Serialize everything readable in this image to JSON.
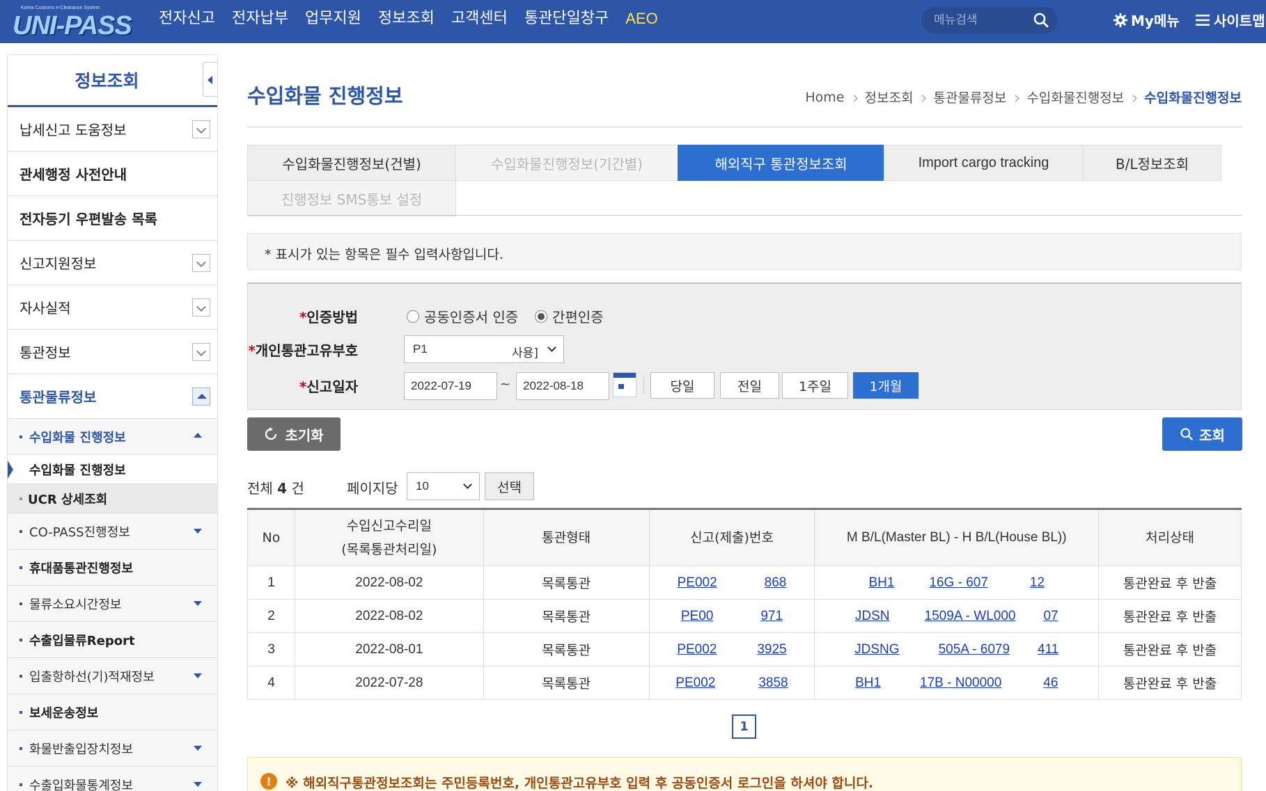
{
  "header": {
    "logo_small": "Korea Customs e-Clearance System",
    "logo_text": "UNI-PASS",
    "nav": [
      "전자신고",
      "전자납부",
      "업무지원",
      "정보조회",
      "고객센터",
      "통관단일창구",
      "AEO"
    ],
    "menu_search_placeholder": "메뉴검색",
    "mymenu_label": "My메뉴",
    "sitemap_label": "사이트맵"
  },
  "sidebar": {
    "title": "정보조회",
    "items": [
      {
        "label": "납세신고 도움정보"
      },
      {
        "label": "관세행정 사전안내"
      },
      {
        "label": "전자등기 우편발송 목록"
      },
      {
        "label": "신고지원정보"
      },
      {
        "label": "자사실적"
      },
      {
        "label": "통관정보"
      },
      {
        "label": "통관물류정보"
      }
    ],
    "sub_open": "수입화물 진행정보",
    "sub_open_children": [
      "수입화물 진행정보",
      "UCR 상세조회"
    ],
    "sub_items": [
      "CO-PASS진행정보",
      "휴대품통관진행정보",
      "물류소요시간정보",
      "수출입물류Report",
      "입출항하선(기)적재정보",
      "보세운송정보",
      "화물반출입장치정보",
      "수출입화물통계정보"
    ]
  },
  "page": {
    "title": "수입화물 진행정보",
    "breadcrumb": [
      "Home",
      "정보조회",
      "통관물류정보",
      "수입화물진행정보",
      "수입화물진행정보"
    ]
  },
  "tabs": [
    "수입화물진행정보(건별)",
    "수입화물진행정보(기간별)",
    "해외직구 통관정보조회",
    "Import cargo tracking",
    "B/L정보조회",
    "진행정보 SMS통보 설정"
  ],
  "notice": "* 표시가 있는 항목은 필수 입력사항입니다.",
  "form": {
    "auth_label": "인증방법",
    "auth_options": [
      "공동인증서 인증",
      "간편인증"
    ],
    "auth_selected": "간편인증",
    "pccc_label": "개인통관고유부호",
    "pccc_value": "P1",
    "pccc_suffix": "사용]",
    "date_label": "신고일자",
    "date_from": "2022-07-19",
    "date_to": "2022-08-18",
    "date_sep": "~",
    "periods": [
      "당일",
      "전일",
      "1주일",
      "1개월"
    ],
    "period_selected": "1개월",
    "reset_label": "초기화",
    "search_label": "조회"
  },
  "results": {
    "total_prefix": "전체",
    "total_count": "4",
    "total_suffix": "건",
    "per_page_label": "페이지당",
    "per_page_value": "10",
    "select_label": "선택",
    "columns": [
      "No",
      "수입신고수리일",
      "(목록통관처리일)",
      "통관형태",
      "신고(제출)번호",
      "M B/L(Master BL) - H B/L(House BL))",
      "처리상태"
    ],
    "rows": [
      {
        "no": "1",
        "date": "2022-08-02",
        "type": "목록통관",
        "decl_a": "PE002",
        "decl_b": "868",
        "bl_a": "BH1",
        "bl_b": "16G - 607",
        "bl_c": "12",
        "status": "통관완료 후 반출"
      },
      {
        "no": "2",
        "date": "2022-08-02",
        "type": "목록통관",
        "decl_a": "PE00",
        "decl_b": "971",
        "bl_a": "JDSN",
        "bl_b": "1509A - WL000",
        "bl_c": "07",
        "status": "통관완료 후 반출"
      },
      {
        "no": "3",
        "date": "2022-08-01",
        "type": "목록통관",
        "decl_a": "PE002",
        "decl_b": "3925",
        "bl_a": "JDSNG",
        "bl_b": "505A - 6079",
        "bl_c": "411",
        "status": "통관완료 후 반출"
      },
      {
        "no": "4",
        "date": "2022-07-28",
        "type": "목록통관",
        "decl_a": "PE002",
        "decl_b": "3858",
        "bl_a": "BH1",
        "bl_b": "17B - N00000",
        "bl_c": "46",
        "status": "통관완료 후 반출"
      }
    ],
    "page": "1"
  },
  "warning": "※ 해외직구통관정보조회는 주민등록번호, 개인통관고유부호 입력 후 공동인증서 로그인을 하셔야 합니다.",
  "colors": {
    "brand": "#2d56a8",
    "accent": "#2d6fd1",
    "required": "#d0021b",
    "warning": "#9a4a12"
  }
}
